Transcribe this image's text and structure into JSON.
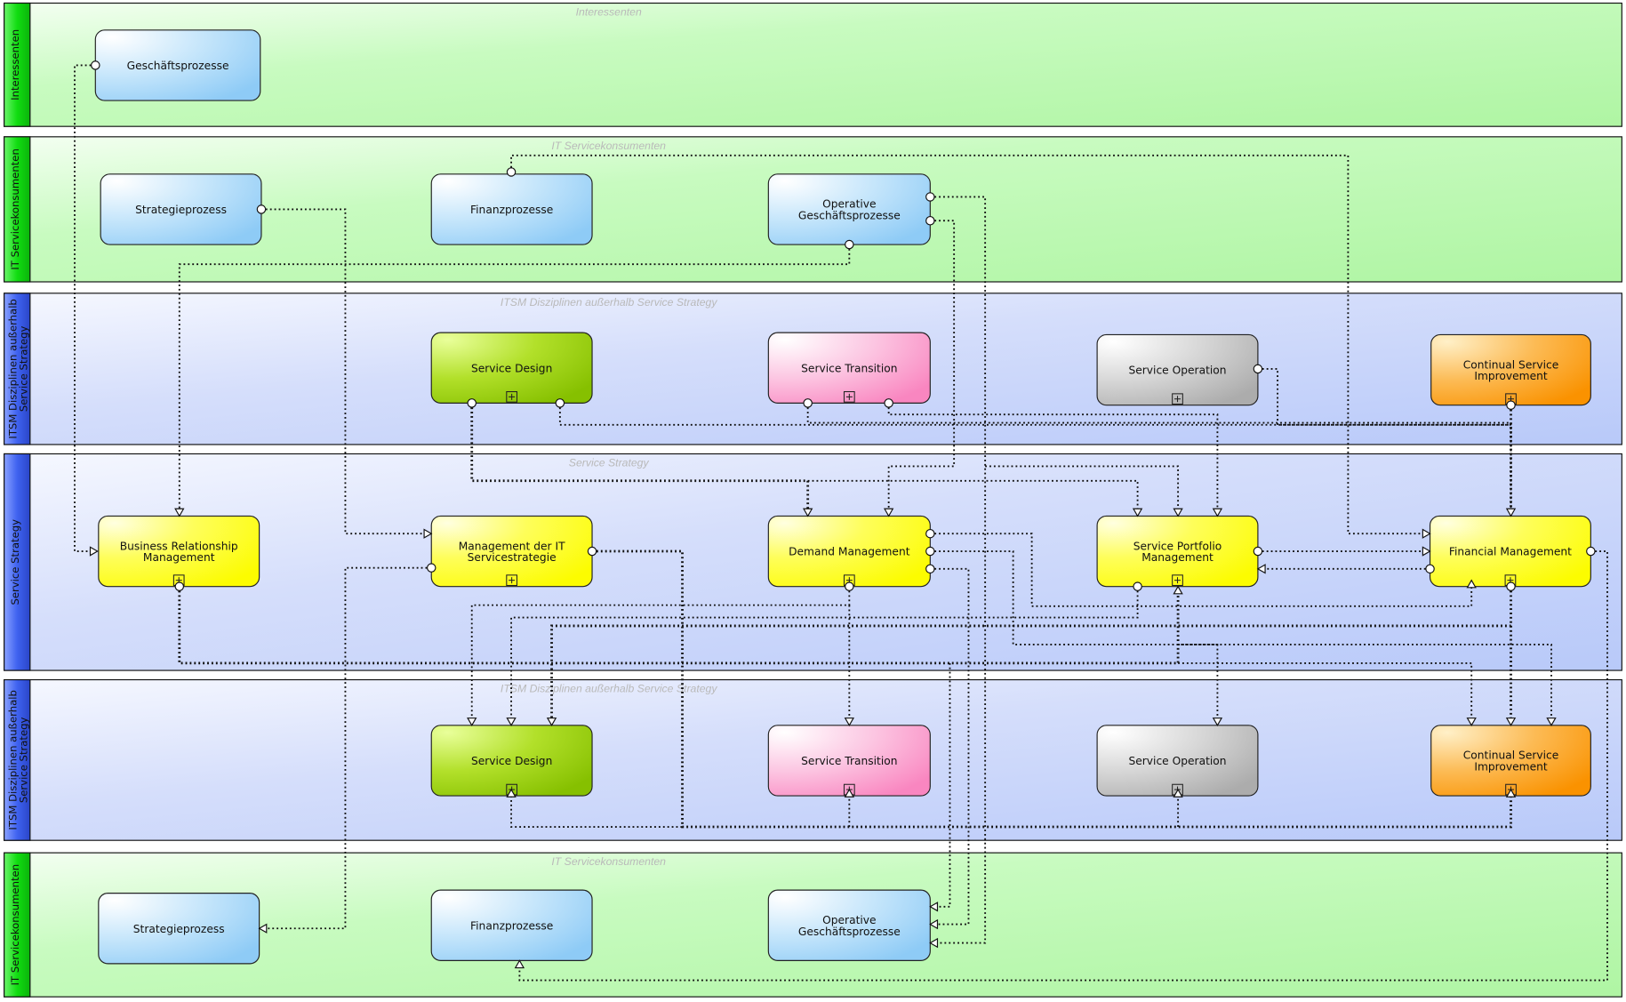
{
  "diagram": {
    "type": "process-landscape",
    "lanes": [
      {
        "id": "lane-1",
        "label": "Interessenten",
        "title": "Interessenten",
        "theme": "green"
      },
      {
        "id": "lane-2",
        "label": "IT Servicekonsumenten",
        "title": "IT Servicekonsumenten",
        "theme": "green"
      },
      {
        "id": "lane-3",
        "label": "ITSM Disziplinen außerhalb Service Strategy",
        "label_lines": [
          "ITSM Disziplinen außerhalb",
          "Service Strategy"
        ],
        "title": "ITSM Disziplinen außerhalb Service Strategy",
        "theme": "blue"
      },
      {
        "id": "lane-4",
        "label": "Service Strategy",
        "title": "Service Strategy",
        "theme": "blue"
      },
      {
        "id": "lane-5",
        "label": "ITSM Disziplinen außerhalb Service Strategy",
        "label_lines": [
          "ITSM Disziplinen außerhalb",
          "Service Strategy"
        ],
        "title": "ITSM Disziplinen außerhalb Service Strategy",
        "theme": "blue"
      },
      {
        "id": "lane-6",
        "label": "IT Servicekonsumenten",
        "title": "IT Servicekonsumenten",
        "theme": "green"
      }
    ],
    "nodes": [
      {
        "id": "n-geschaeftsprozesse",
        "lane": "lane-1",
        "lines": [
          "Geschäftsprozesse"
        ],
        "style": "blue",
        "subprocess": false
      },
      {
        "id": "n-strategieprozess-top",
        "lane": "lane-2",
        "lines": [
          "Strategieprozess"
        ],
        "style": "blue",
        "subprocess": false
      },
      {
        "id": "n-finanzprozesse-top",
        "lane": "lane-2",
        "lines": [
          "Finanzprozesse"
        ],
        "style": "blue",
        "subprocess": false
      },
      {
        "id": "n-operative-top",
        "lane": "lane-2",
        "lines": [
          "Operative",
          "Geschäftsprozesse"
        ],
        "style": "blue",
        "subprocess": false
      },
      {
        "id": "n-service-design-top",
        "lane": "lane-3",
        "lines": [
          "Service Design"
        ],
        "style": "green",
        "subprocess": true
      },
      {
        "id": "n-service-transition-top",
        "lane": "lane-3",
        "lines": [
          "Service Transition"
        ],
        "style": "pink",
        "subprocess": true
      },
      {
        "id": "n-service-operation-top",
        "lane": "lane-3",
        "lines": [
          "Service Operation"
        ],
        "style": "gray",
        "subprocess": true
      },
      {
        "id": "n-csi-top",
        "lane": "lane-3",
        "lines": [
          "Continual Service",
          "Improvement"
        ],
        "style": "orange",
        "subprocess": true
      },
      {
        "id": "n-brm",
        "lane": "lane-4",
        "lines": [
          "Business Relationship",
          "Management"
        ],
        "style": "yellow",
        "subprocess": true
      },
      {
        "id": "n-mgmt-it-strategie",
        "lane": "lane-4",
        "lines": [
          "Management der IT",
          "Servicestrategie"
        ],
        "style": "yellow",
        "subprocess": true
      },
      {
        "id": "n-demand",
        "lane": "lane-4",
        "lines": [
          "Demand Management"
        ],
        "style": "yellow",
        "subprocess": true
      },
      {
        "id": "n-portfolio",
        "lane": "lane-4",
        "lines": [
          "Service Portfolio",
          "Management"
        ],
        "style": "yellow",
        "subprocess": true
      },
      {
        "id": "n-financial",
        "lane": "lane-4",
        "lines": [
          "Financial Management"
        ],
        "style": "yellow",
        "subprocess": true
      },
      {
        "id": "n-service-design-bot",
        "lane": "lane-5",
        "lines": [
          "Service Design"
        ],
        "style": "green",
        "subprocess": true
      },
      {
        "id": "n-service-transition-bot",
        "lane": "lane-5",
        "lines": [
          "Service Transition"
        ],
        "style": "pink",
        "subprocess": true
      },
      {
        "id": "n-service-operation-bot",
        "lane": "lane-5",
        "lines": [
          "Service Operation"
        ],
        "style": "gray",
        "subprocess": true
      },
      {
        "id": "n-csi-bot",
        "lane": "lane-5",
        "lines": [
          "Continual Service",
          "Improvement"
        ],
        "style": "orange",
        "subprocess": true
      },
      {
        "id": "n-strategieprozess-bot",
        "lane": "lane-6",
        "lines": [
          "Strategieprozess"
        ],
        "style": "blue",
        "subprocess": false
      },
      {
        "id": "n-finanzprozesse-bot",
        "lane": "lane-6",
        "lines": [
          "Finanzprozesse"
        ],
        "style": "blue",
        "subprocess": false
      },
      {
        "id": "n-operative-bot",
        "lane": "lane-6",
        "lines": [
          "Operative",
          "Geschäftsprozesse"
        ],
        "style": "blue",
        "subprocess": false
      }
    ],
    "colors": {
      "green_lane_bar": "#22dd22",
      "blue_lane_bar": "#3355ee",
      "green_lane_fill": "#b4f7a8",
      "blue_lane_fill": "#c0d0fa",
      "node_blue": "#9fd3f7",
      "node_green": "#8dc800",
      "node_pink": "#fa8ac4",
      "node_gray": "#b8b8b8",
      "node_orange": "#fb9a10",
      "node_yellow": "#fdfd10",
      "edge": "#111111"
    }
  }
}
